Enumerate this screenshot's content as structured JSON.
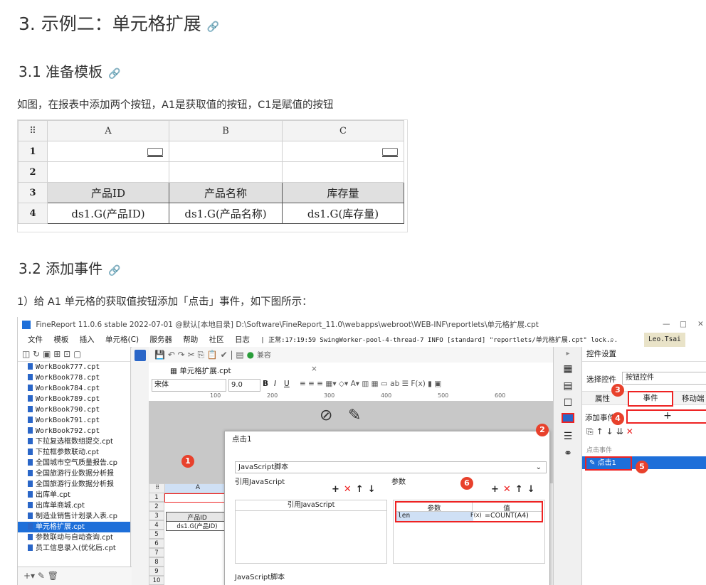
{
  "headings": {
    "h1": "3. 示例二：单元格扩展",
    "h2a": "3.1 准备模板",
    "h2b": "3.2 添加事件",
    "link_icon": "link-icon"
  },
  "paragraphs": {
    "p1": "如图，在报表中添加两个按钮，A1是获取值的按钮，C1是赋值的按钮",
    "p2": "1）给 A1 单元格的获取值按钮添加「点击」事件，如下图所示："
  },
  "sheet": {
    "corner": "⠿",
    "cols": [
      "A",
      "B",
      "C"
    ],
    "rows": [
      "1",
      "2",
      "3",
      "4"
    ],
    "headers": [
      "产品ID",
      "产品名称",
      "库存量"
    ],
    "formulas": [
      "ds1.G(产品ID)",
      "ds1.G(产品名称)",
      "ds1.G(库存量)"
    ]
  },
  "app": {
    "title": "FineReport 11.0.6 stable 2022-07-01 @默认[本地目录]    D:\\Software\\FineReport_11.0\\webapps\\webroot\\WEB-INF\\reportlets\\单元格扩展.cpt",
    "window_controls": [
      "—",
      "□",
      "✕"
    ],
    "menu": [
      "文件",
      "模板",
      "插入",
      "单元格(C)",
      "服务器",
      "帮助",
      "社区",
      "日志",
      "| 正常:17:19:59 SwingWorker-pool-4-thread-7 INFO [standard] \"reportlets/单元格扩展.cpt\" lock..."
    ],
    "user": "Leo.Tsai",
    "files": [
      "WorkBook777.cpt",
      "WorkBook778.cpt",
      "WorkBook784.cpt",
      "WorkBook789.cpt",
      "WorkBook790.cpt",
      "WorkBook791.cpt",
      "WorkBook792.cpt",
      "下拉复选框数组提交.cpt",
      "下拉框参数联动.cpt",
      "全国城市空气质量报告.cp",
      "全国旅游行业数据分析报",
      "全国旅游行业数据分析报",
      "出库单.cpt",
      "出库单商城.cpt",
      "制造业销售计划录入表.cp",
      "单元格扩展.cpt",
      "参数联动与自动查询.cpt",
      "员工信息录入(优化后.cpt"
    ],
    "selected_file_index": 15,
    "tab_label": "单元格扩展.cpt",
    "tab_close": "×",
    "compat": "兼容",
    "font_name": "宋体",
    "font_size": "9.0",
    "ruler": [
      "100",
      "200",
      "300",
      "400",
      "500",
      "600"
    ],
    "grid_col": "A",
    "grid_rows": [
      "1",
      "2",
      "3",
      "4",
      "5",
      "6",
      "7",
      "8",
      "9",
      "10"
    ],
    "grid_header": "产品ID",
    "grid_formula": "ds1.G(产品ID)",
    "grid_formula2": "ds",
    "right_panel": {
      "title": "控件设置",
      "select_label": "选择控件",
      "select_value": "按钮控件",
      "tabs": [
        "属性",
        "事件",
        "移动端"
      ],
      "add_event": "添加事件",
      "add_btn": "+",
      "event_group": "点击事件",
      "event_item": "点击1"
    },
    "dialog": {
      "title": "点击1",
      "type": "JavaScript脚本",
      "ref_js": "引用JavaScript",
      "ref_js_col": "引用JavaScript",
      "params": "参数",
      "param_cols": [
        "参数",
        "值"
      ],
      "param_name": "len",
      "param_fx": "F(x)",
      "param_value": "=COUNT(A4)",
      "js_label": "JavaScript脚本"
    },
    "badges": [
      "1",
      "2",
      "3",
      "4",
      "5",
      "6"
    ]
  },
  "colors": {
    "accent": "#1e6fd9",
    "red": "#e22222",
    "badge": "#e8412c"
  }
}
